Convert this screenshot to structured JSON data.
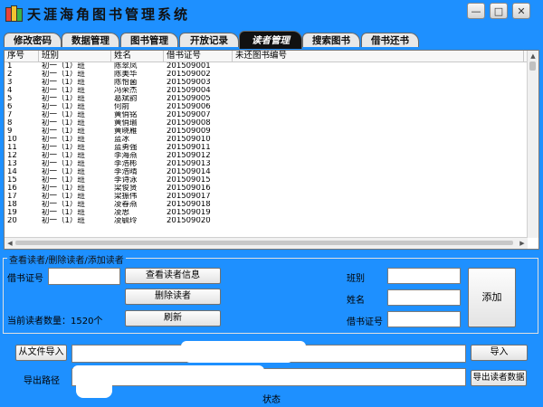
{
  "window": {
    "title": "天涯海角图书管理系统",
    "min_glyph": "—",
    "max_glyph": "□",
    "close_glyph": "✕"
  },
  "tabs": [
    "修改密码",
    "数据管理",
    "图书管理",
    "开放记录",
    "读者管理",
    "搜索图书",
    "借书还书"
  ],
  "active_tab": 4,
  "table": {
    "columns": [
      "序号",
      "班别",
      "姓名",
      "借书证号",
      "未还图书编号"
    ],
    "rows": [
      [
        "1",
        "初一（1）班",
        "陈翠凤",
        "201509001",
        ""
      ],
      [
        "2",
        "初一（1）班",
        "陈美华",
        "201509002",
        ""
      ],
      [
        "3",
        "初一（1）班",
        "陈怡菌",
        "201509003",
        ""
      ],
      [
        "4",
        "初一（1）班",
        "冯荣杰",
        "201509004",
        ""
      ],
      [
        "5",
        "初一（1）班",
        "葛斌韵",
        "201509005",
        ""
      ],
      [
        "6",
        "初一（1）班",
        "何前",
        "201509006",
        ""
      ],
      [
        "7",
        "初一（1）班",
        "黄俏铭",
        "201509007",
        ""
      ],
      [
        "8",
        "初一（1）班",
        "黄俏瑜",
        "201509008",
        ""
      ],
      [
        "9",
        "初一（1）班",
        "黄晓雁",
        "201509009",
        ""
      ],
      [
        "10",
        "初一（1）班",
        "蓝冰",
        "201509010",
        ""
      ],
      [
        "11",
        "初一（1）班",
        "蓝勇强",
        "201509011",
        ""
      ],
      [
        "12",
        "初一（1）班",
        "李海燕",
        "201509012",
        ""
      ],
      [
        "13",
        "初一（1）班",
        "李浩彬",
        "201509013",
        ""
      ],
      [
        "14",
        "初一（1）班",
        "李浩晴",
        "201509014",
        ""
      ],
      [
        "15",
        "初一（1）班",
        "李诗泳",
        "201509015",
        ""
      ],
      [
        "16",
        "初一（1）班",
        "梁俊贤",
        "201509016",
        ""
      ],
      [
        "17",
        "初一（1）班",
        "梁振伟",
        "201509017",
        ""
      ],
      [
        "18",
        "初一（1）班",
        "凌春燕",
        "201509018",
        ""
      ],
      [
        "19",
        "初一（1）班",
        "凌思",
        "201509019",
        ""
      ],
      [
        "20",
        "初一（1）班",
        "凌毓玲",
        "201509020",
        ""
      ]
    ]
  },
  "reader_panel": {
    "group_title": "查看读者/删除读者/添加读者",
    "card_label": "借书证号",
    "view_button": "查看读者信息",
    "delete_button": "删除读者",
    "refresh_button": "刷新",
    "count_text": "当前读者数量：1520个",
    "class_label": "班别",
    "name_label": "姓名",
    "card_label_right": "借书证号",
    "add_button": "添加"
  },
  "import_bar": {
    "import_file_button": "从文件导入",
    "import_button": "导入"
  },
  "export_bar": {
    "path_label": "导出路径",
    "export_button": "导出读者数据"
  },
  "status": "状态"
}
